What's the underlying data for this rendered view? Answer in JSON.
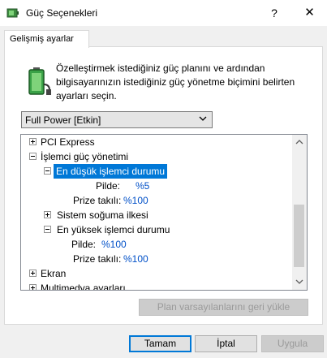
{
  "window": {
    "title": "Güç Seçenekleri",
    "help_glyph": "?",
    "close_glyph": "✕"
  },
  "tab": {
    "label": "Gelişmiş ayarlar"
  },
  "intro_text": "Özelleştirmek istediğiniz güç planını ve ardından bilgisayarınızın istediğiniz güç yönetme biçimini belirten ayarları seçin.",
  "plan_select": {
    "value": "Full Power [Etkin]"
  },
  "tree": {
    "pci_express": "PCI Express",
    "processor": "İşlemci güç yönetimi",
    "min_state": "En düşük işlemci durumu",
    "min_battery": {
      "label": "Pilde:",
      "value": "%5"
    },
    "min_plugged": {
      "label": "Prize takılı:",
      "value": "%100"
    },
    "cooling": "Sistem soğuma ilkesi",
    "max_state": "En yüksek işlemci durumu",
    "max_battery": {
      "label": "Pilde:",
      "value": "%100"
    },
    "max_plugged": {
      "label": "Prize takılı:",
      "value": "%100"
    },
    "display": "Ekran",
    "multimedia": "Multimedya ayarları"
  },
  "buttons": {
    "restore": "Plan varsayılanlarını geri yükle",
    "ok": "Tamam",
    "cancel": "İptal",
    "apply": "Uygula"
  },
  "colors": {
    "selection": "#0078d7",
    "link": "#0050c8"
  }
}
